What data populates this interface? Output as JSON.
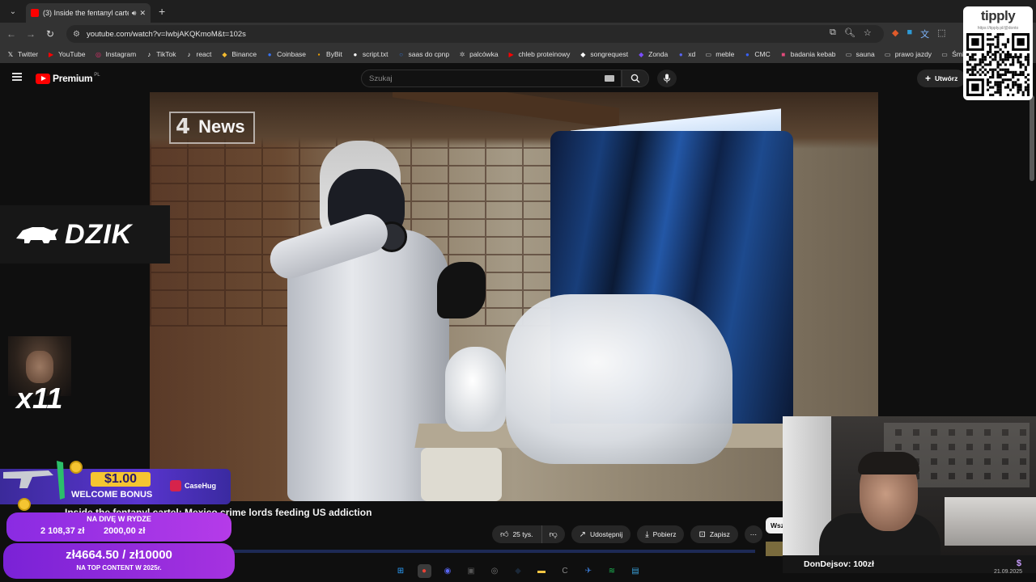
{
  "browser": {
    "tab_title": "(3) Inside the fentanyl carte",
    "new_tab": "+",
    "url": "youtube.com/watch?v=IwbjAKQKmoM&t=102s"
  },
  "bookmarks": [
    {
      "label": "Twitter",
      "icon": "x-icon",
      "color": "#ffffff"
    },
    {
      "label": "YouTube",
      "icon": "youtube-icon",
      "color": "#ff0000"
    },
    {
      "label": "Instagram",
      "icon": "instagram-icon",
      "color": "#e1306c"
    },
    {
      "label": "TikTok",
      "icon": "tiktok-icon",
      "color": "#ffffff"
    },
    {
      "label": "react",
      "icon": "tiktok-icon",
      "color": "#ffffff"
    },
    {
      "label": "Binance",
      "icon": "binance-icon",
      "color": "#f3ba2f"
    },
    {
      "label": "Coinbase",
      "icon": "coinbase-icon",
      "color": "#3773f5"
    },
    {
      "label": "ByBit",
      "icon": "bybit-icon",
      "color": "#f7a600"
    },
    {
      "label": "script.txt",
      "icon": "github-icon",
      "color": "#ffffff"
    },
    {
      "label": "saas do cpnp",
      "icon": "circle-icon",
      "color": "#2f6fd1"
    },
    {
      "label": "palcówka",
      "icon": "gear-icon",
      "color": "#bbbbbb"
    },
    {
      "label": "chleb proteinowy",
      "icon": "youtube-icon",
      "color": "#ff0000"
    },
    {
      "label": "songrequest",
      "icon": "diamond-icon",
      "color": "#ffffff"
    },
    {
      "label": "Zonda",
      "icon": "zonda-icon",
      "color": "#7b4dff"
    },
    {
      "label": "xd",
      "icon": "discord-icon",
      "color": "#5865f2"
    },
    {
      "label": "meble",
      "icon": "folder-icon",
      "color": "#cccccc"
    },
    {
      "label": "CMC",
      "icon": "cmc-icon",
      "color": "#3861fb"
    },
    {
      "label": "badania kebab",
      "icon": "bookmark-icon",
      "color": "#e24a7b"
    },
    {
      "label": "sauna",
      "icon": "folder-icon",
      "color": "#cccccc"
    },
    {
      "label": "prawo jazdy",
      "icon": "folder-icon",
      "color": "#cccccc"
    },
    {
      "label": "Śmieciarka",
      "icon": "folder-icon",
      "color": "#cccccc"
    }
  ],
  "youtube": {
    "brand": "Premium",
    "country": "PL",
    "search_placeholder": "Szukaj",
    "create_label": "Utwórz",
    "video_title": "Inside the fentanyl cartel: Mexico crime lords feeding US addiction",
    "watermark_number": "4",
    "watermark_word": "News",
    "likes": "25 tys.",
    "share": "Udostępnij",
    "download": "Pobierz",
    "save": "Zapisz",
    "chip": "Wsz",
    "progress_fraction": 0.0
  },
  "overlays": {
    "dzik": "DZIK",
    "multiplier": "x11",
    "promo_price": "$1.00",
    "promo_text": "WELCOME BONUS",
    "promo_brand": "CaseHug",
    "goal1_label": "NA DIVĘ W RYDZE",
    "goal1_current": "2 108,37 zł",
    "goal1_target": "2000,00 zł",
    "goal2_amount": "zł4664.50 / zł10000",
    "goal2_label": "NA TOP CONTENT W 2025r.",
    "donation": "DonDejsov:  100zł",
    "donation_icon": "$",
    "tipply": "tipply",
    "tipply_url": "https://tipply.pl/@donto"
  },
  "taskbar": [
    {
      "name": "windows-start-icon",
      "color": "#2aa0ff",
      "glyph": "⊞"
    },
    {
      "name": "chrome-icon",
      "color": "#e94235",
      "glyph": "●"
    },
    {
      "name": "discord-icon",
      "color": "#5865f2",
      "glyph": "◉"
    },
    {
      "name": "obs-icon",
      "color": "#555555",
      "glyph": "▣"
    },
    {
      "name": "app-icon",
      "color": "#777777",
      "glyph": "◎"
    },
    {
      "name": "steam-icon",
      "color": "#1b2838",
      "glyph": "◆"
    },
    {
      "name": "folder-icon",
      "color": "#f5c542",
      "glyph": "▬"
    },
    {
      "name": "ccleaner-icon",
      "color": "#888888",
      "glyph": "C"
    },
    {
      "name": "network-icon",
      "color": "#3a7bd5",
      "glyph": "✈"
    },
    {
      "name": "spotify-icon",
      "color": "#1db954",
      "glyph": "≋"
    },
    {
      "name": "notepad-icon",
      "color": "#39a0d8",
      "glyph": "▤"
    }
  ],
  "clock": "21.09.2025"
}
